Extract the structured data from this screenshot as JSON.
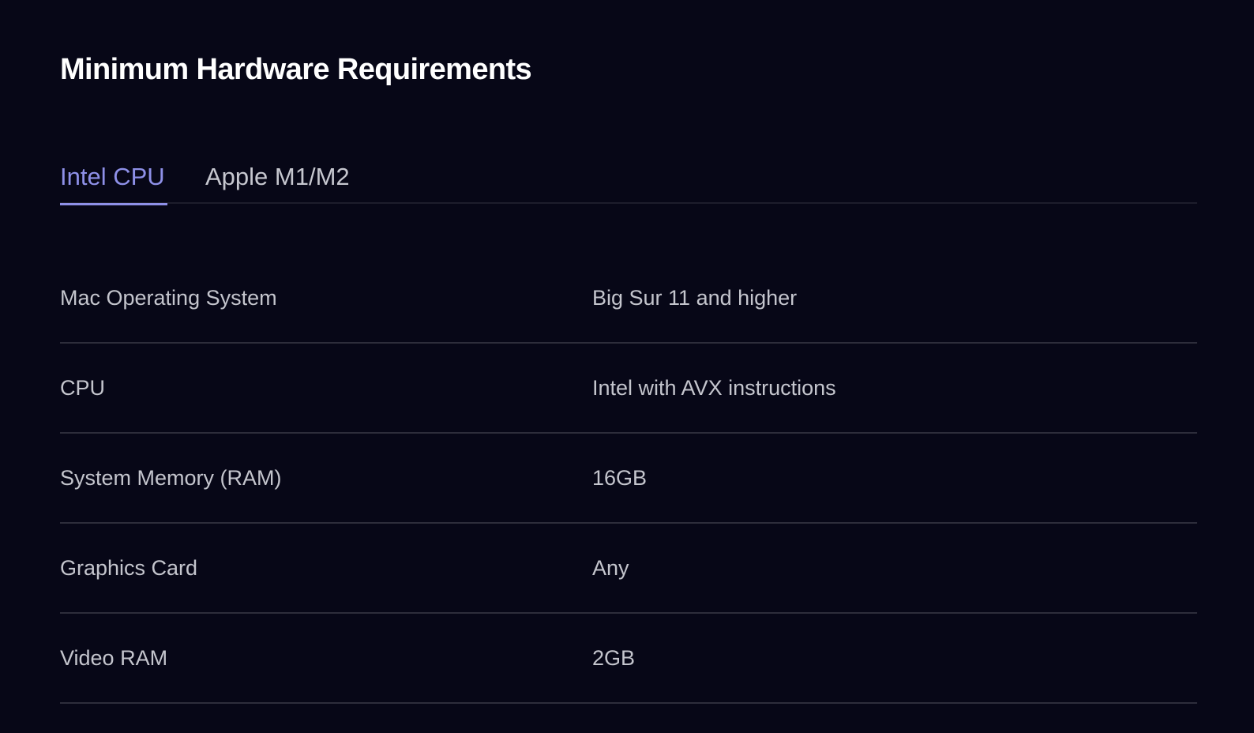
{
  "section": {
    "title": "Minimum Hardware Requirements"
  },
  "tabs": [
    {
      "label": "Intel CPU",
      "active": true
    },
    {
      "label": "Apple M1/M2",
      "active": false
    }
  ],
  "requirements": {
    "rows": [
      {
        "label": "Mac Operating System",
        "value": "Big Sur 11 and higher"
      },
      {
        "label": "CPU",
        "value": "Intel with AVX instructions"
      },
      {
        "label": "System Memory (RAM)",
        "value": "16GB"
      },
      {
        "label": "Graphics Card",
        "value": "Any"
      },
      {
        "label": "Video RAM",
        "value": "2GB"
      }
    ]
  },
  "colors": {
    "background": "#070717",
    "accent": "#8e90e8",
    "text": "#c4c5cd",
    "heading": "#ffffff",
    "divider": "#2d2d3b"
  }
}
